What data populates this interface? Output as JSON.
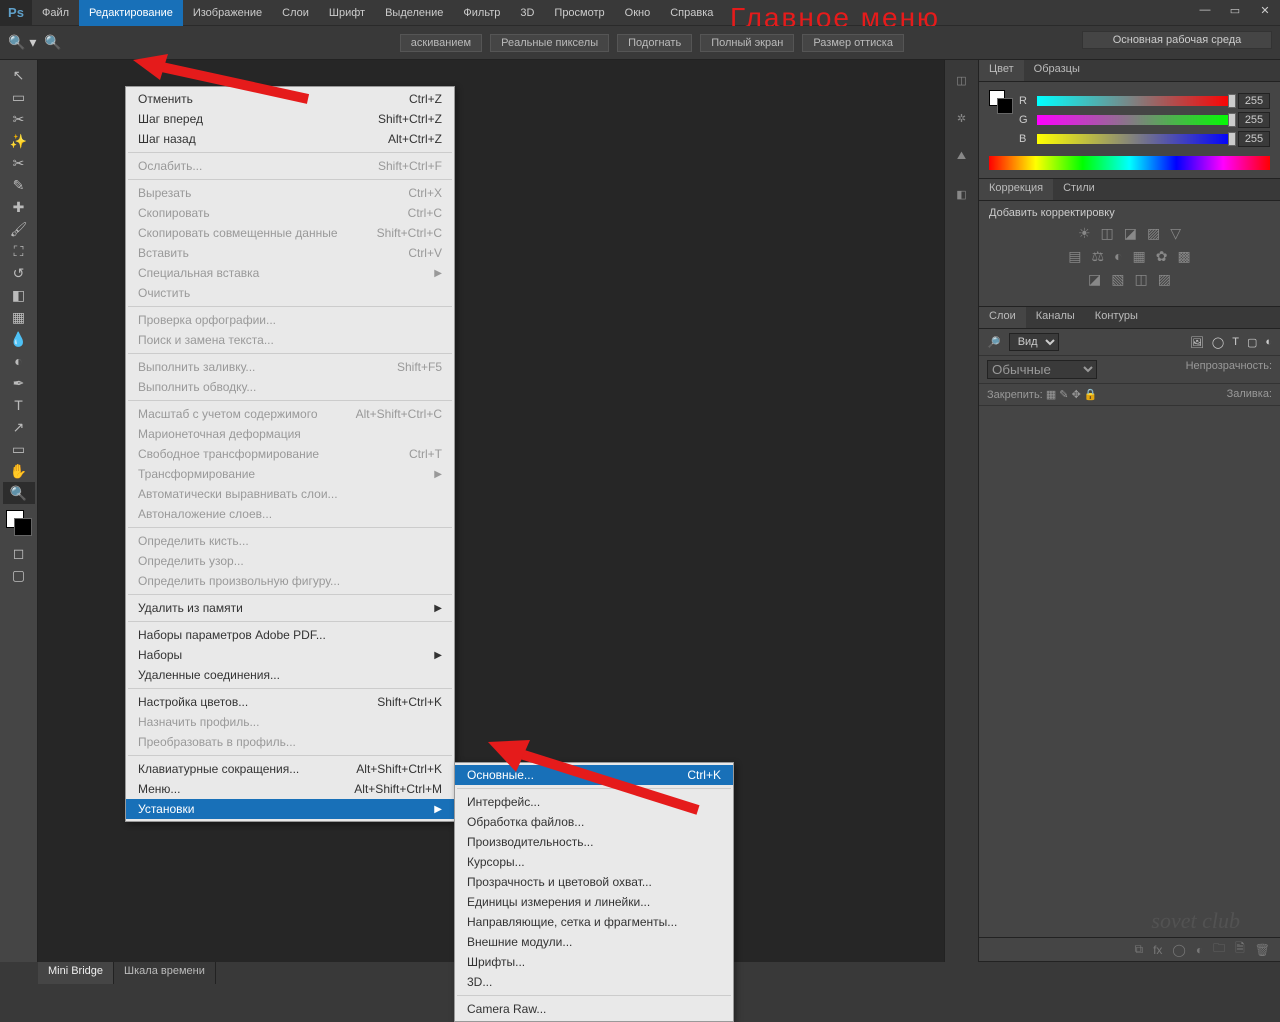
{
  "annotation": "Главное меню",
  "menubar": [
    "Файл",
    "Редактирование",
    "Изображение",
    "Слои",
    "Шрифт",
    "Выделение",
    "Фильтр",
    "3D",
    "Просмотр",
    "Окно",
    "Справка"
  ],
  "active_menu_index": 1,
  "optbar": {
    "buttons": [
      "аскиванием",
      "Реальные пикселы",
      "Подогнать",
      "Полный экран",
      "Размер оттиска"
    ],
    "workspace": "Основная рабочая среда"
  },
  "edit_menu": [
    {
      "t": "item",
      "label": "Отменить",
      "sc": "Ctrl+Z"
    },
    {
      "t": "item",
      "label": "Шаг вперед",
      "sc": "Shift+Ctrl+Z"
    },
    {
      "t": "item",
      "label": "Шаг назад",
      "sc": "Alt+Ctrl+Z"
    },
    {
      "t": "sep"
    },
    {
      "t": "item",
      "label": "Ослабить...",
      "sc": "Shift+Ctrl+F",
      "dis": true
    },
    {
      "t": "sep"
    },
    {
      "t": "item",
      "label": "Вырезать",
      "sc": "Ctrl+X",
      "dis": true
    },
    {
      "t": "item",
      "label": "Скопировать",
      "sc": "Ctrl+C",
      "dis": true
    },
    {
      "t": "item",
      "label": "Скопировать совмещенные данные",
      "sc": "Shift+Ctrl+C",
      "dis": true
    },
    {
      "t": "item",
      "label": "Вставить",
      "sc": "Ctrl+V",
      "dis": true
    },
    {
      "t": "item",
      "label": "Специальная вставка",
      "arrow": true,
      "dis": true
    },
    {
      "t": "item",
      "label": "Очистить",
      "dis": true
    },
    {
      "t": "sep"
    },
    {
      "t": "item",
      "label": "Проверка орфографии...",
      "dis": true
    },
    {
      "t": "item",
      "label": "Поиск и замена текста...",
      "dis": true
    },
    {
      "t": "sep"
    },
    {
      "t": "item",
      "label": "Выполнить заливку...",
      "sc": "Shift+F5",
      "dis": true
    },
    {
      "t": "item",
      "label": "Выполнить обводку...",
      "dis": true
    },
    {
      "t": "sep"
    },
    {
      "t": "item",
      "label": "Масштаб с учетом содержимого",
      "sc": "Alt+Shift+Ctrl+C",
      "dis": true
    },
    {
      "t": "item",
      "label": "Марионеточная деформация",
      "dis": true
    },
    {
      "t": "item",
      "label": "Свободное трансформирование",
      "sc": "Ctrl+T",
      "dis": true
    },
    {
      "t": "item",
      "label": "Трансформирование",
      "arrow": true,
      "dis": true
    },
    {
      "t": "item",
      "label": "Автоматически выравнивать слои...",
      "dis": true
    },
    {
      "t": "item",
      "label": "Автоналожение слоев...",
      "dis": true
    },
    {
      "t": "sep"
    },
    {
      "t": "item",
      "label": "Определить кисть...",
      "dis": true
    },
    {
      "t": "item",
      "label": "Определить узор...",
      "dis": true
    },
    {
      "t": "item",
      "label": "Определить произвольную фигуру...",
      "dis": true
    },
    {
      "t": "sep"
    },
    {
      "t": "item",
      "label": "Удалить из памяти",
      "arrow": true
    },
    {
      "t": "sep"
    },
    {
      "t": "item",
      "label": "Наборы параметров Adobe PDF..."
    },
    {
      "t": "item",
      "label": "Наборы",
      "arrow": true
    },
    {
      "t": "item",
      "label": "Удаленные соединения..."
    },
    {
      "t": "sep"
    },
    {
      "t": "item",
      "label": "Настройка цветов...",
      "sc": "Shift+Ctrl+K"
    },
    {
      "t": "item",
      "label": "Назначить профиль...",
      "dis": true
    },
    {
      "t": "item",
      "label": "Преобразовать в профиль...",
      "dis": true
    },
    {
      "t": "sep"
    },
    {
      "t": "item",
      "label": "Клавиатурные сокращения...",
      "sc": "Alt+Shift+Ctrl+K"
    },
    {
      "t": "item",
      "label": "Меню...",
      "sc": "Alt+Shift+Ctrl+M"
    },
    {
      "t": "item",
      "label": "Установки",
      "arrow": true,
      "hl": true
    }
  ],
  "prefs_submenu": [
    {
      "t": "item",
      "label": "Основные...",
      "sc": "Ctrl+K",
      "hl": true
    },
    {
      "t": "sep"
    },
    {
      "t": "item",
      "label": "Интерфейс..."
    },
    {
      "t": "item",
      "label": "Обработка файлов..."
    },
    {
      "t": "item",
      "label": "Производительность..."
    },
    {
      "t": "item",
      "label": "Курсоры..."
    },
    {
      "t": "item",
      "label": "Прозрачность и цветовой охват..."
    },
    {
      "t": "item",
      "label": "Единицы измерения и линейки..."
    },
    {
      "t": "item",
      "label": "Направляющие, сетка и фрагменты..."
    },
    {
      "t": "item",
      "label": "Внешние модули..."
    },
    {
      "t": "item",
      "label": "Шрифты..."
    },
    {
      "t": "item",
      "label": "3D..."
    },
    {
      "t": "sep"
    },
    {
      "t": "item",
      "label": "Camera Raw..."
    }
  ],
  "panels": {
    "color": {
      "tabs": [
        "Цвет",
        "Образцы"
      ],
      "r": "255",
      "g": "255",
      "b": "255"
    },
    "corrections": {
      "tabs": [
        "Коррекция",
        "Стили"
      ],
      "hint": "Добавить корректировку"
    },
    "layers": {
      "tabs": [
        "Слои",
        "Каналы",
        "Контуры"
      ],
      "kind": "Вид",
      "mode": "Обычные",
      "opacity_lbl": "Непрозрачность:",
      "lock_lbl": "Закрепить:",
      "fill_lbl": "Заливка:"
    }
  },
  "bottom_tabs": [
    "Mini Bridge",
    "Шкала времени"
  ],
  "watermark": "sovet club"
}
